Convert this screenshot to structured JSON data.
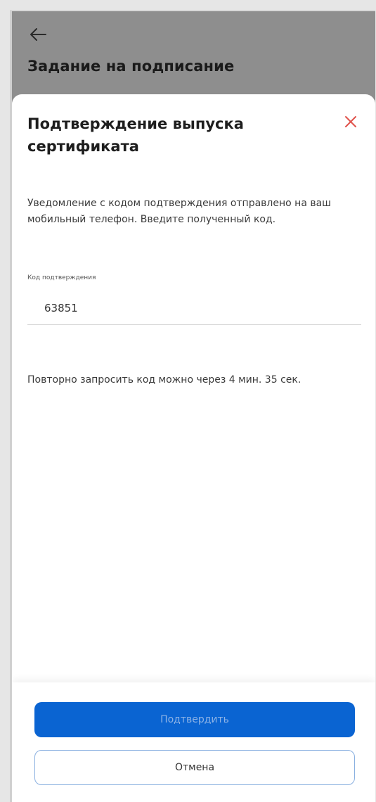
{
  "header": {
    "back_icon": "arrow-left-icon",
    "title": "Задание на подписание"
  },
  "modal": {
    "title": "Подтверждение выпуска сертификата",
    "close_icon": "close-icon",
    "close_color": "#e0524b",
    "info_text": "Уведомление с кодом подтверждения отправлено на ваш мобильный телефон. Введите полученный код.",
    "code_field": {
      "label": "Код подтверждения",
      "value": "63851"
    },
    "resend_text": "Повторно запросить код можно через 4 мин. 35 сек."
  },
  "actions": {
    "confirm_label": "Подтвердить",
    "cancel_label": "Отмена",
    "primary_color": "#0a64d2"
  }
}
